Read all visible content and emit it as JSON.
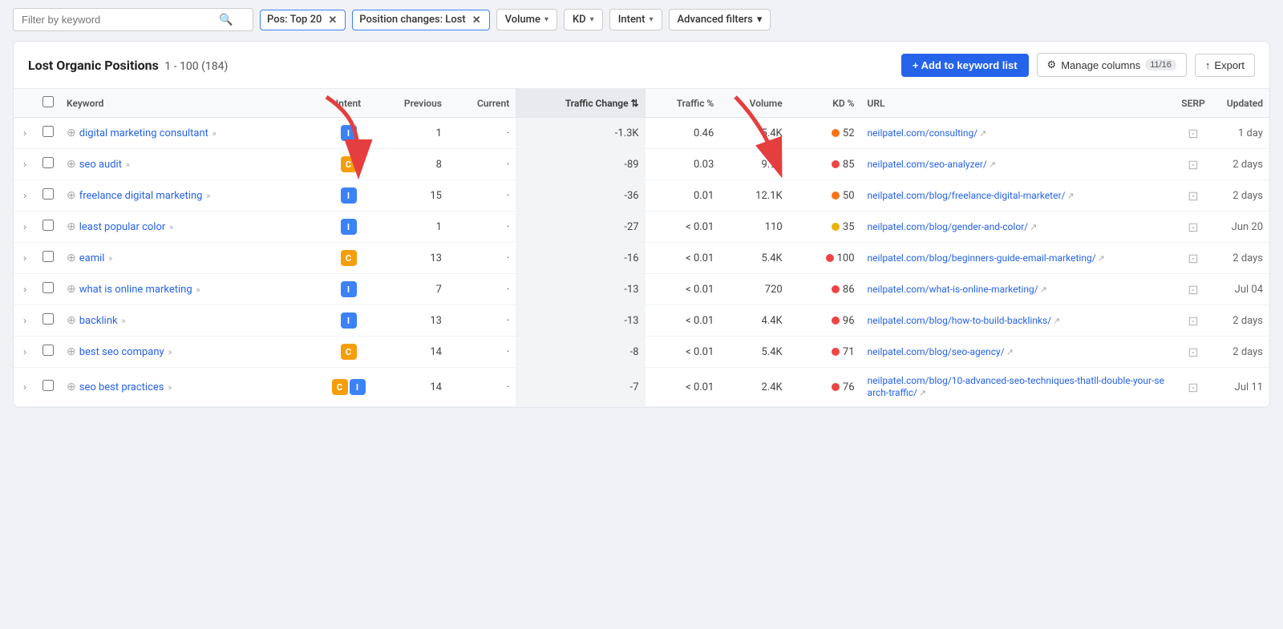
{
  "filterBar": {
    "searchPlaceholder": "Filter by keyword",
    "chips": [
      {
        "id": "pos",
        "label": "Pos: Top 20"
      },
      {
        "id": "position-changes",
        "label": "Position changes: Lost"
      }
    ],
    "dropdowns": [
      {
        "id": "volume",
        "label": "Volume"
      },
      {
        "id": "kd",
        "label": "KD"
      },
      {
        "id": "intent",
        "label": "Intent"
      }
    ],
    "advancedFilters": "Advanced filters"
  },
  "card": {
    "title": "Lost Organic Positions",
    "rangeStart": "1",
    "rangeEnd": "100",
    "total": "184",
    "addKeywordLabel": "+ Add to keyword list",
    "manageColumnsLabel": "Manage columns",
    "manageColumnsBadge": "11/16",
    "exportLabel": "Export"
  },
  "table": {
    "columns": [
      {
        "id": "expand",
        "label": ""
      },
      {
        "id": "checkbox",
        "label": ""
      },
      {
        "id": "keyword",
        "label": "Keyword"
      },
      {
        "id": "intent",
        "label": "Intent"
      },
      {
        "id": "previous",
        "label": "Previous"
      },
      {
        "id": "current",
        "label": "Current"
      },
      {
        "id": "traffic-change",
        "label": "Traffic Change"
      },
      {
        "id": "traffic-pct",
        "label": "Traffic %"
      },
      {
        "id": "volume",
        "label": "Volume"
      },
      {
        "id": "kd",
        "label": "KD %"
      },
      {
        "id": "url",
        "label": "URL"
      },
      {
        "id": "serp",
        "label": "SERP"
      },
      {
        "id": "updated",
        "label": "Updated"
      }
    ],
    "rows": [
      {
        "keyword": "digital marketing consultant",
        "intents": [
          "I"
        ],
        "previous": "1",
        "current": "·",
        "trafficChange": "-1.3K",
        "trafficPct": "0.46",
        "volume": "5.4K",
        "kd": "52",
        "kdColor": "orange",
        "url": "neilpatel.com/consulting/",
        "updated": "1 day"
      },
      {
        "keyword": "seo audit",
        "intents": [
          "C"
        ],
        "previous": "8",
        "current": "·",
        "trafficChange": "-89",
        "trafficPct": "0.03",
        "volume": "9.9K",
        "kd": "85",
        "kdColor": "red",
        "url": "neilpatel.com/seo-analyzer/",
        "updated": "2 days"
      },
      {
        "keyword": "freelance digital marketing",
        "intents": [
          "I"
        ],
        "previous": "15",
        "current": "·",
        "trafficChange": "-36",
        "trafficPct": "0.01",
        "volume": "12.1K",
        "kd": "50",
        "kdColor": "orange",
        "url": "neilpatel.com/blog/freelance-digital-marketer/",
        "updated": "2 days"
      },
      {
        "keyword": "least popular color",
        "intents": [
          "I"
        ],
        "previous": "1",
        "current": "·",
        "trafficChange": "-27",
        "trafficPct": "< 0.01",
        "volume": "110",
        "kd": "35",
        "kdColor": "yellow",
        "url": "neilpatel.com/blog/gender-and-color/",
        "updated": "Jun 20"
      },
      {
        "keyword": "eamil",
        "intents": [
          "C"
        ],
        "previous": "13",
        "current": "·",
        "trafficChange": "-16",
        "trafficPct": "< 0.01",
        "volume": "5.4K",
        "kd": "100",
        "kdColor": "red",
        "url": "neilpatel.com/blog/beginners-guide-email-marketing/",
        "updated": "2 days"
      },
      {
        "keyword": "what is online marketing",
        "intents": [
          "I"
        ],
        "previous": "7",
        "current": "·",
        "trafficChange": "-13",
        "trafficPct": "< 0.01",
        "volume": "720",
        "kd": "86",
        "kdColor": "red",
        "url": "neilpatel.com/what-is-online-marketing/",
        "updated": "Jul 04"
      },
      {
        "keyword": "backlink",
        "intents": [
          "I"
        ],
        "previous": "13",
        "current": "·",
        "trafficChange": "-13",
        "trafficPct": "< 0.01",
        "volume": "4.4K",
        "kd": "96",
        "kdColor": "red",
        "url": "neilpatel.com/blog/how-to-build-backlinks/",
        "updated": "2 days"
      },
      {
        "keyword": "best seo company",
        "intents": [
          "C"
        ],
        "previous": "14",
        "current": "·",
        "trafficChange": "-8",
        "trafficPct": "< 0.01",
        "volume": "5.4K",
        "kd": "71",
        "kdColor": "red",
        "url": "neilpatel.com/blog/seo-agency/",
        "updated": "2 days"
      },
      {
        "keyword": "seo best practices",
        "intents": [
          "C",
          "I"
        ],
        "previous": "14",
        "current": "·",
        "trafficChange": "-7",
        "trafficPct": "< 0.01",
        "volume": "2.4K",
        "kd": "76",
        "kdColor": "red",
        "url": "neilpatel.com/blog/10-advanced-seo-techniques-thatll-double-your-search-traffic/",
        "updated": "Jul 11"
      }
    ]
  },
  "icons": {
    "search": "🔍",
    "close": "✕",
    "chevronDown": "▾",
    "plus": "＋",
    "gear": "⚙",
    "upload": "↑",
    "externalLink": "↗",
    "serp": "⊡",
    "expand": "›",
    "plusCircle": "⊕"
  }
}
